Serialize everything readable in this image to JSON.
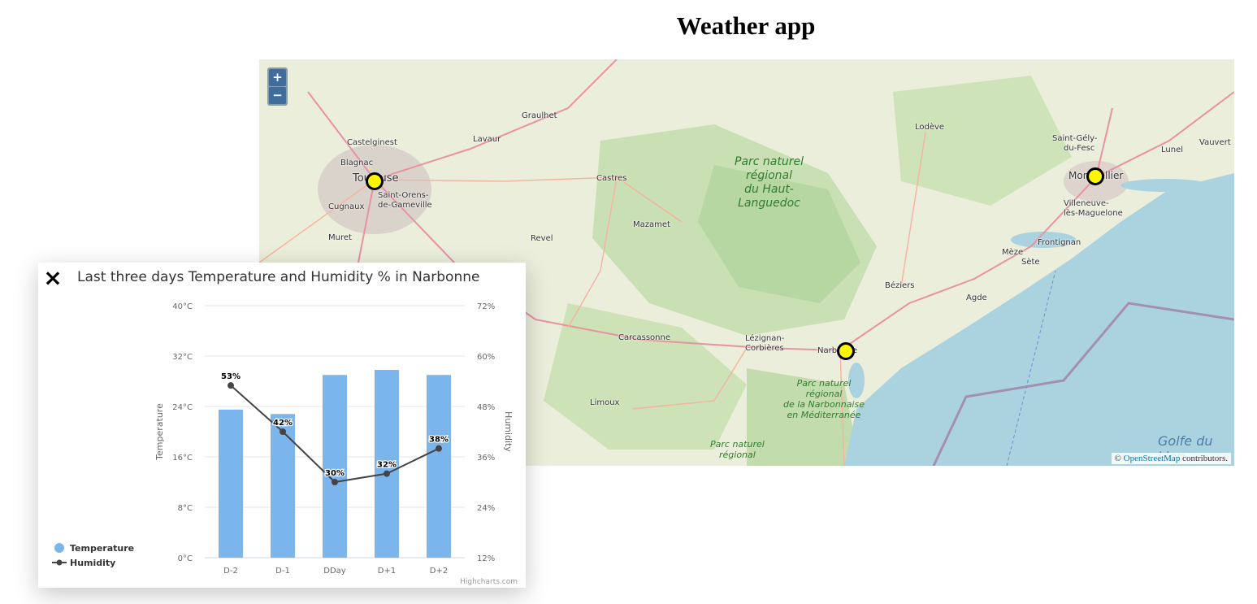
{
  "page": {
    "title": "Weather app"
  },
  "map": {
    "zoom_in_label": "+",
    "zoom_out_label": "−",
    "attribution_prefix": "© ",
    "attribution_link": "OpenStreetMap",
    "attribution_suffix": " contributors.",
    "places": [
      "Castelginest",
      "Blagnac",
      "Toulouse",
      "Saint-Orens-",
      "de-Gameville",
      "Cugnaux",
      "Muret",
      "Graulhet",
      "Lavaur",
      "Castres",
      "Mazamet",
      "Revel",
      "Carcassonne",
      "Limoux",
      "Lézignan-",
      "Corbières",
      "Narbonne",
      "Béziers",
      "Agde",
      "Lodève",
      "Saint-Gély-",
      "du-Fesc",
      "Montpellier",
      "Villeneuve-",
      "lès-Maguelone",
      "Frontignan",
      "Mèze",
      "Sète",
      "Lunel",
      "Vauvert"
    ],
    "parks": [
      "Parc naturel\nrégional\ndu Haut-\nLanguedoc",
      "Parc naturel\nrégional\nde la Narbonnaise\nen Méditerranée",
      "Parc naturel\nrégional"
    ],
    "sea_label": "Golfe du Lion",
    "markers": [
      "Toulouse",
      "Montpellier",
      "Narbonne"
    ],
    "colors": {
      "land": "#e9eedb",
      "sea": "#aad3df",
      "forest": "#add19e",
      "road": "#e892a2",
      "marker": "#fff700"
    }
  },
  "popup": {
    "close_icon": "×",
    "title": "Last three days Temperature and Humidity % in Narbonne",
    "credit": "Highcharts.com"
  },
  "chart_data": {
    "type": "bar",
    "categories": [
      "D-2",
      "D-1",
      "DDay",
      "D+1",
      "D+2"
    ],
    "series": [
      {
        "name": "Temperature",
        "type": "bar",
        "axis": "left",
        "color": "#7cb5ec",
        "values": [
          23.5,
          22.8,
          29.0,
          29.8,
          29.0
        ]
      },
      {
        "name": "Humidity",
        "type": "line",
        "axis": "right",
        "color": "#434348",
        "values": [
          53,
          42,
          30,
          32,
          38
        ],
        "labels": [
          "53%",
          "42%",
          "30%",
          "32%",
          "38%"
        ]
      }
    ],
    "ylabel": "Temperature",
    "y2label": "Humidity",
    "ylim": [
      0,
      40
    ],
    "y2lim": [
      12,
      72
    ],
    "yticks": [
      "0°C",
      "8°C",
      "16°C",
      "24°C",
      "32°C",
      "40°C"
    ],
    "y2ticks": [
      "12%",
      "24%",
      "36%",
      "48%",
      "60%",
      "72%"
    ],
    "grid": true,
    "legend": "bottom-left"
  }
}
